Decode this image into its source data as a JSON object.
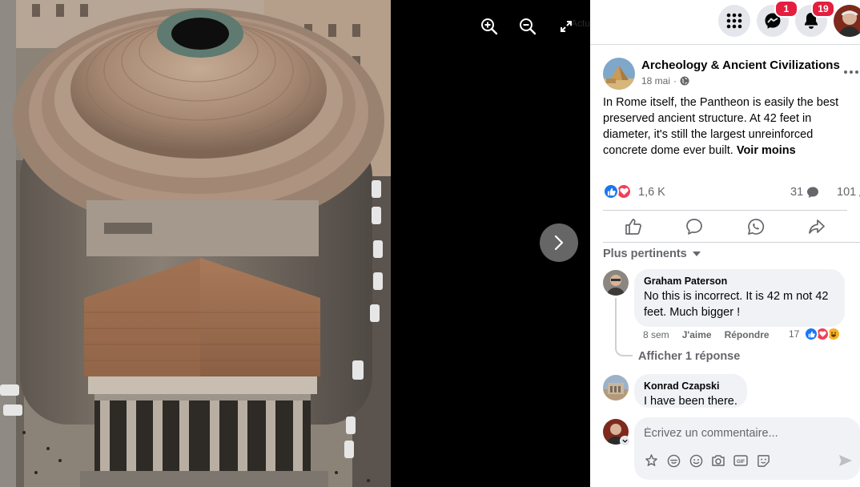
{
  "viewer": {
    "zoom_in_icon": "zoom-in-icon",
    "zoom_out_icon": "zoom-out-icon",
    "fullscreen_icon": "fullscreen-icon",
    "next_icon": "chevron-right-icon",
    "faded_label": "Actualiser l'écran"
  },
  "topbar": {
    "menu_icon": "grid-menu-icon",
    "messenger_icon": "messenger-icon",
    "messenger_badge": "1",
    "notifications_icon": "bell-icon",
    "notifications_badge": "19"
  },
  "post": {
    "page_name": "Archeology & Ancient Civilizations",
    "date": "18 mai",
    "privacy_icon": "globe-icon",
    "text": "In Rome itself, the Pantheon is easily the best preserved ancient structure. At 42 feet in diameter, it's still the largest unreinforced concrete dome ever built.",
    "see_less": "Voir moins",
    "reactions_count": "1,6 K",
    "comments_count": "31",
    "shares_count": "101"
  },
  "filter": {
    "label": "Plus pertinents"
  },
  "comments": [
    {
      "author": "Graham Paterson",
      "text": "No this is incorrect. It is 42 m not 42 feet. Much bigger !",
      "time": "8 sem",
      "like_label": "J'aime",
      "reply_label": "Répondre",
      "reaction_count": "17",
      "replies_label": "Afficher 1 réponse"
    },
    {
      "author": "Konrad Czapski",
      "text": "I have been there."
    }
  ],
  "composer": {
    "placeholder": "Écrivez un commentaire..."
  },
  "colors": {
    "facebook_blue": "#1877f2",
    "love_red": "#f33e58",
    "badge_red": "#e41e3f",
    "bubble_gray": "#f0f2f5",
    "secondary_text": "#65676b"
  }
}
